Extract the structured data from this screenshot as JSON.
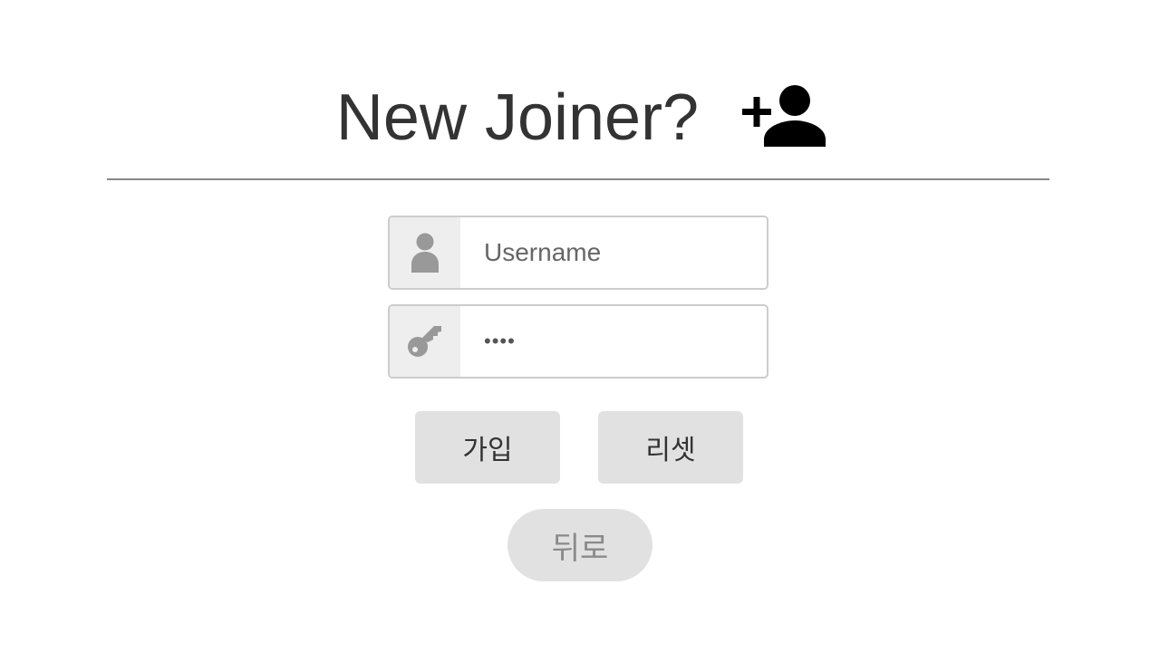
{
  "header": {
    "title": "New Joiner?",
    "icon": "add-user-icon"
  },
  "form": {
    "username": {
      "icon": "user-icon",
      "placeholder": "Username",
      "value": ""
    },
    "password": {
      "icon": "key-icon",
      "value": "••••"
    }
  },
  "buttons": {
    "join_label": "가입",
    "reset_label": "리셋",
    "back_label": "뒤로"
  },
  "colors": {
    "title_text": "#333333",
    "divider": "#888888",
    "button_bg": "#e1e1e1",
    "addon_bg": "#eeeeee",
    "icon_gray": "#999999",
    "back_text": "#8a8a8a"
  }
}
